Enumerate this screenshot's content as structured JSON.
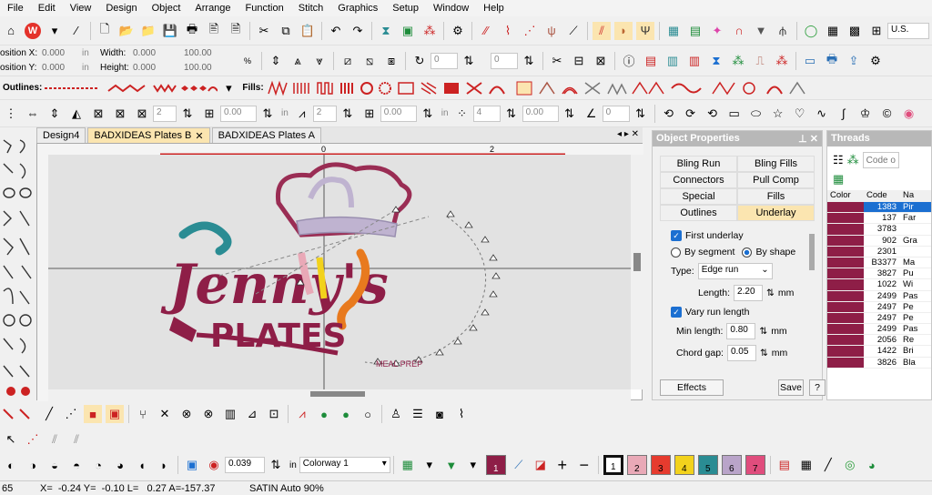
{
  "menu": [
    "File",
    "Edit",
    "View",
    "Design",
    "Object",
    "Arrange",
    "Function",
    "Stitch",
    "Graphics",
    "Setup",
    "Window",
    "Help"
  ],
  "toolbar": {
    "locale": "U.S.",
    "position_x_label": "osition X:",
    "position_y_label": "osition Y:",
    "position_x": "0.000",
    "position_y": "0.000",
    "unit_in": "in",
    "width_label": "Width:",
    "height_label": "Height:",
    "width": "0.000",
    "height": "0.000",
    "width_pct": "100.00",
    "height_pct": "100.00",
    "rotate_value": "0",
    "slant_value": "0",
    "outlines_label": "Outlines:",
    "fills_label": "Fills:"
  },
  "toolbar4": {
    "v1": "2",
    "v2": "0.00",
    "v3": "2",
    "v4": "0.00",
    "v5": "4",
    "v6": "0.00",
    "v7": "0",
    "unit_in": "in"
  },
  "tabs": [
    {
      "label": "Design4"
    },
    {
      "label": "BADXIDEAS Plates B"
    },
    {
      "label": "BADXIDEAS Plates  A"
    }
  ],
  "ruler": {
    "zero": "0",
    "two": "2"
  },
  "object_properties": {
    "title": "Object Properties",
    "tabs": [
      "Bling Run",
      "Bling Fills",
      "Connectors",
      "Pull Comp",
      "Special",
      "Fills",
      "Outlines",
      "Underlay"
    ],
    "first_underlay": "First underlay",
    "by_segment": "By segment",
    "by_shape": "By shape",
    "type_label": "Type:",
    "type_value": "Edge run",
    "length_label": "Length:",
    "length_value": "2.20",
    "vary_run": "Vary run length",
    "min_length_label": "Min length:",
    "min_length_value": "0.80",
    "chord_gap_label": "Chord gap:",
    "chord_gap_value": "0.05",
    "unit_mm": "mm",
    "effects": "Effects",
    "save": "Save",
    "help": "?"
  },
  "threads": {
    "title": "Threads",
    "search_placeholder": "Code o",
    "col_color": "Color",
    "col_code": "Code",
    "col_name": "Na",
    "rows": [
      {
        "code": "1383",
        "name": "Pir",
        "selected": true
      },
      {
        "code": "137",
        "name": "Far"
      },
      {
        "code": "3783",
        "name": ""
      },
      {
        "code": "902",
        "name": "Gra"
      },
      {
        "code": "2301",
        "name": ""
      },
      {
        "code": "B3377",
        "name": "Ma"
      },
      {
        "code": "3827",
        "name": "Pu"
      },
      {
        "code": "1022",
        "name": "Wi"
      },
      {
        "code": "2499",
        "name": "Pas"
      },
      {
        "code": "2497",
        "name": "Pe"
      },
      {
        "code": "2497",
        "name": "Pe"
      },
      {
        "code": "2499",
        "name": "Pas"
      },
      {
        "code": "2056",
        "name": "Re"
      },
      {
        "code": "1422",
        "name": "Bri"
      },
      {
        "code": "3826",
        "name": "Bla"
      }
    ]
  },
  "bottom": {
    "scale_value": "0.039",
    "unit_in": "in",
    "colorway": "Colorway 1",
    "swatches": [
      {
        "n": "1",
        "color": "#8e1e47"
      },
      {
        "n": "2",
        "color": "#e9a9b7"
      },
      {
        "n": "3",
        "color": "#e63b2e"
      },
      {
        "n": "4",
        "color": "#f2d21c"
      },
      {
        "n": "5",
        "color": "#2a8c93"
      },
      {
        "n": "6",
        "color": "#b9a4c9"
      },
      {
        "n": "7",
        "color": "#e04d7d"
      }
    ]
  },
  "status": {
    "left": "65",
    "coords": "X=  -0.24 Y=  -0.10 L=   0.27 A=-157.37",
    "mode": "SATIN Auto 90%"
  },
  "design": {
    "title_text": "Jenny's",
    "subtitle_text": "PLATES",
    "ring_text": "MEAL PREP"
  }
}
